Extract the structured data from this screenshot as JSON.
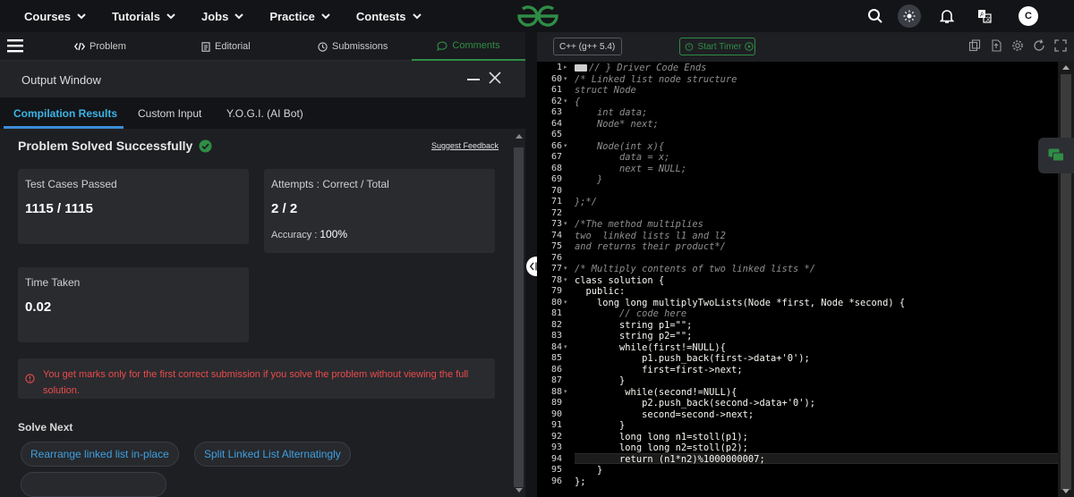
{
  "nav": {
    "items": [
      {
        "label": "Courses"
      },
      {
        "label": "Tutorials"
      },
      {
        "label": "Jobs"
      },
      {
        "label": "Practice"
      },
      {
        "label": "Contests"
      }
    ],
    "avatar_initial": "C",
    "brand_color": "#2f8d46"
  },
  "problem_tabs": [
    {
      "label": "Problem",
      "icon": "code-icon"
    },
    {
      "label": "Editorial",
      "icon": "document-icon"
    },
    {
      "label": "Submissions",
      "icon": "clock-icon"
    },
    {
      "label": "Comments",
      "icon": "comment-icon"
    }
  ],
  "output_window": {
    "title": "Output Window",
    "tabs": [
      {
        "label": "Compilation Results"
      },
      {
        "label": "Custom Input"
      },
      {
        "label": "Y.O.G.I. (AI Bot)"
      }
    ],
    "status": "Problem Solved Successfully",
    "suggest_feedback": "Suggest Feedback",
    "test_cases_label": "Test Cases Passed",
    "test_cases_value": "1115 / 1115",
    "attempts_label": "Attempts : Correct / Total",
    "attempts_value": "2 / 2",
    "accuracy_label": "Accuracy :",
    "accuracy_value": "100%",
    "time_label": "Time Taken",
    "time_value": "0.02",
    "alert": "You get marks only for the first correct submission if you solve the problem without viewing the full solution.",
    "solve_next_title": "Solve Next",
    "solve_next": [
      {
        "label": "Rearrange linked list in-place"
      },
      {
        "label": "Split Linked List Alternatingly"
      }
    ]
  },
  "editor": {
    "language": "C++ (g++ 5.4)",
    "timer_label": "Start Timer",
    "lines": [
      {
        "n": "1",
        "text": "// } Driver Code Ends"
      },
      {
        "n": "60",
        "text": "/* Linked list node structure"
      },
      {
        "n": "61",
        "text": "struct Node"
      },
      {
        "n": "62",
        "text": "{"
      },
      {
        "n": "63",
        "text": "    int data;"
      },
      {
        "n": "64",
        "text": "    Node* next;"
      },
      {
        "n": "65",
        "text": ""
      },
      {
        "n": "66",
        "text": "    Node(int x){"
      },
      {
        "n": "67",
        "text": "        data = x;"
      },
      {
        "n": "68",
        "text": "        next = NULL;"
      },
      {
        "n": "69",
        "text": "    }"
      },
      {
        "n": "70",
        "text": ""
      },
      {
        "n": "71",
        "text": "};*/"
      },
      {
        "n": "72",
        "text": ""
      },
      {
        "n": "73",
        "text": "/*The method multiplies"
      },
      {
        "n": "74",
        "text": "two  linked lists l1 and l2"
      },
      {
        "n": "75",
        "text": "and returns their product*/"
      },
      {
        "n": "76",
        "text": ""
      },
      {
        "n": "77",
        "text": "/* Multiply contents of two linked lists */"
      },
      {
        "n": "78",
        "text": "class solution {"
      },
      {
        "n": "79",
        "text": "  public:"
      },
      {
        "n": "80",
        "text": "    long long multiplyTwoLists(Node *first, Node *second) {"
      },
      {
        "n": "81",
        "text": "        // code here"
      },
      {
        "n": "82",
        "text": "        string p1=\"\";"
      },
      {
        "n": "83",
        "text": "        string p2=\"\";"
      },
      {
        "n": "84",
        "text": "        while(first!=NULL){"
      },
      {
        "n": "85",
        "text": "            p1.push_back(first->data+'0');"
      },
      {
        "n": "86",
        "text": "            first=first->next;"
      },
      {
        "n": "87",
        "text": "        }"
      },
      {
        "n": "88",
        "text": "         while(second!=NULL){"
      },
      {
        "n": "89",
        "text": "            p2.push_back(second->data+'0');"
      },
      {
        "n": "90",
        "text": "            second=second->next;"
      },
      {
        "n": "91",
        "text": "        }"
      },
      {
        "n": "92",
        "text": "        long long n1=stoll(p1);"
      },
      {
        "n": "93",
        "text": "        long long n2=stoll(p2);"
      },
      {
        "n": "94",
        "text": "        return (n1*n2)%1000000007;"
      },
      {
        "n": "95",
        "text": "    }"
      },
      {
        "n": "96",
        "text": "};"
      }
    ]
  }
}
